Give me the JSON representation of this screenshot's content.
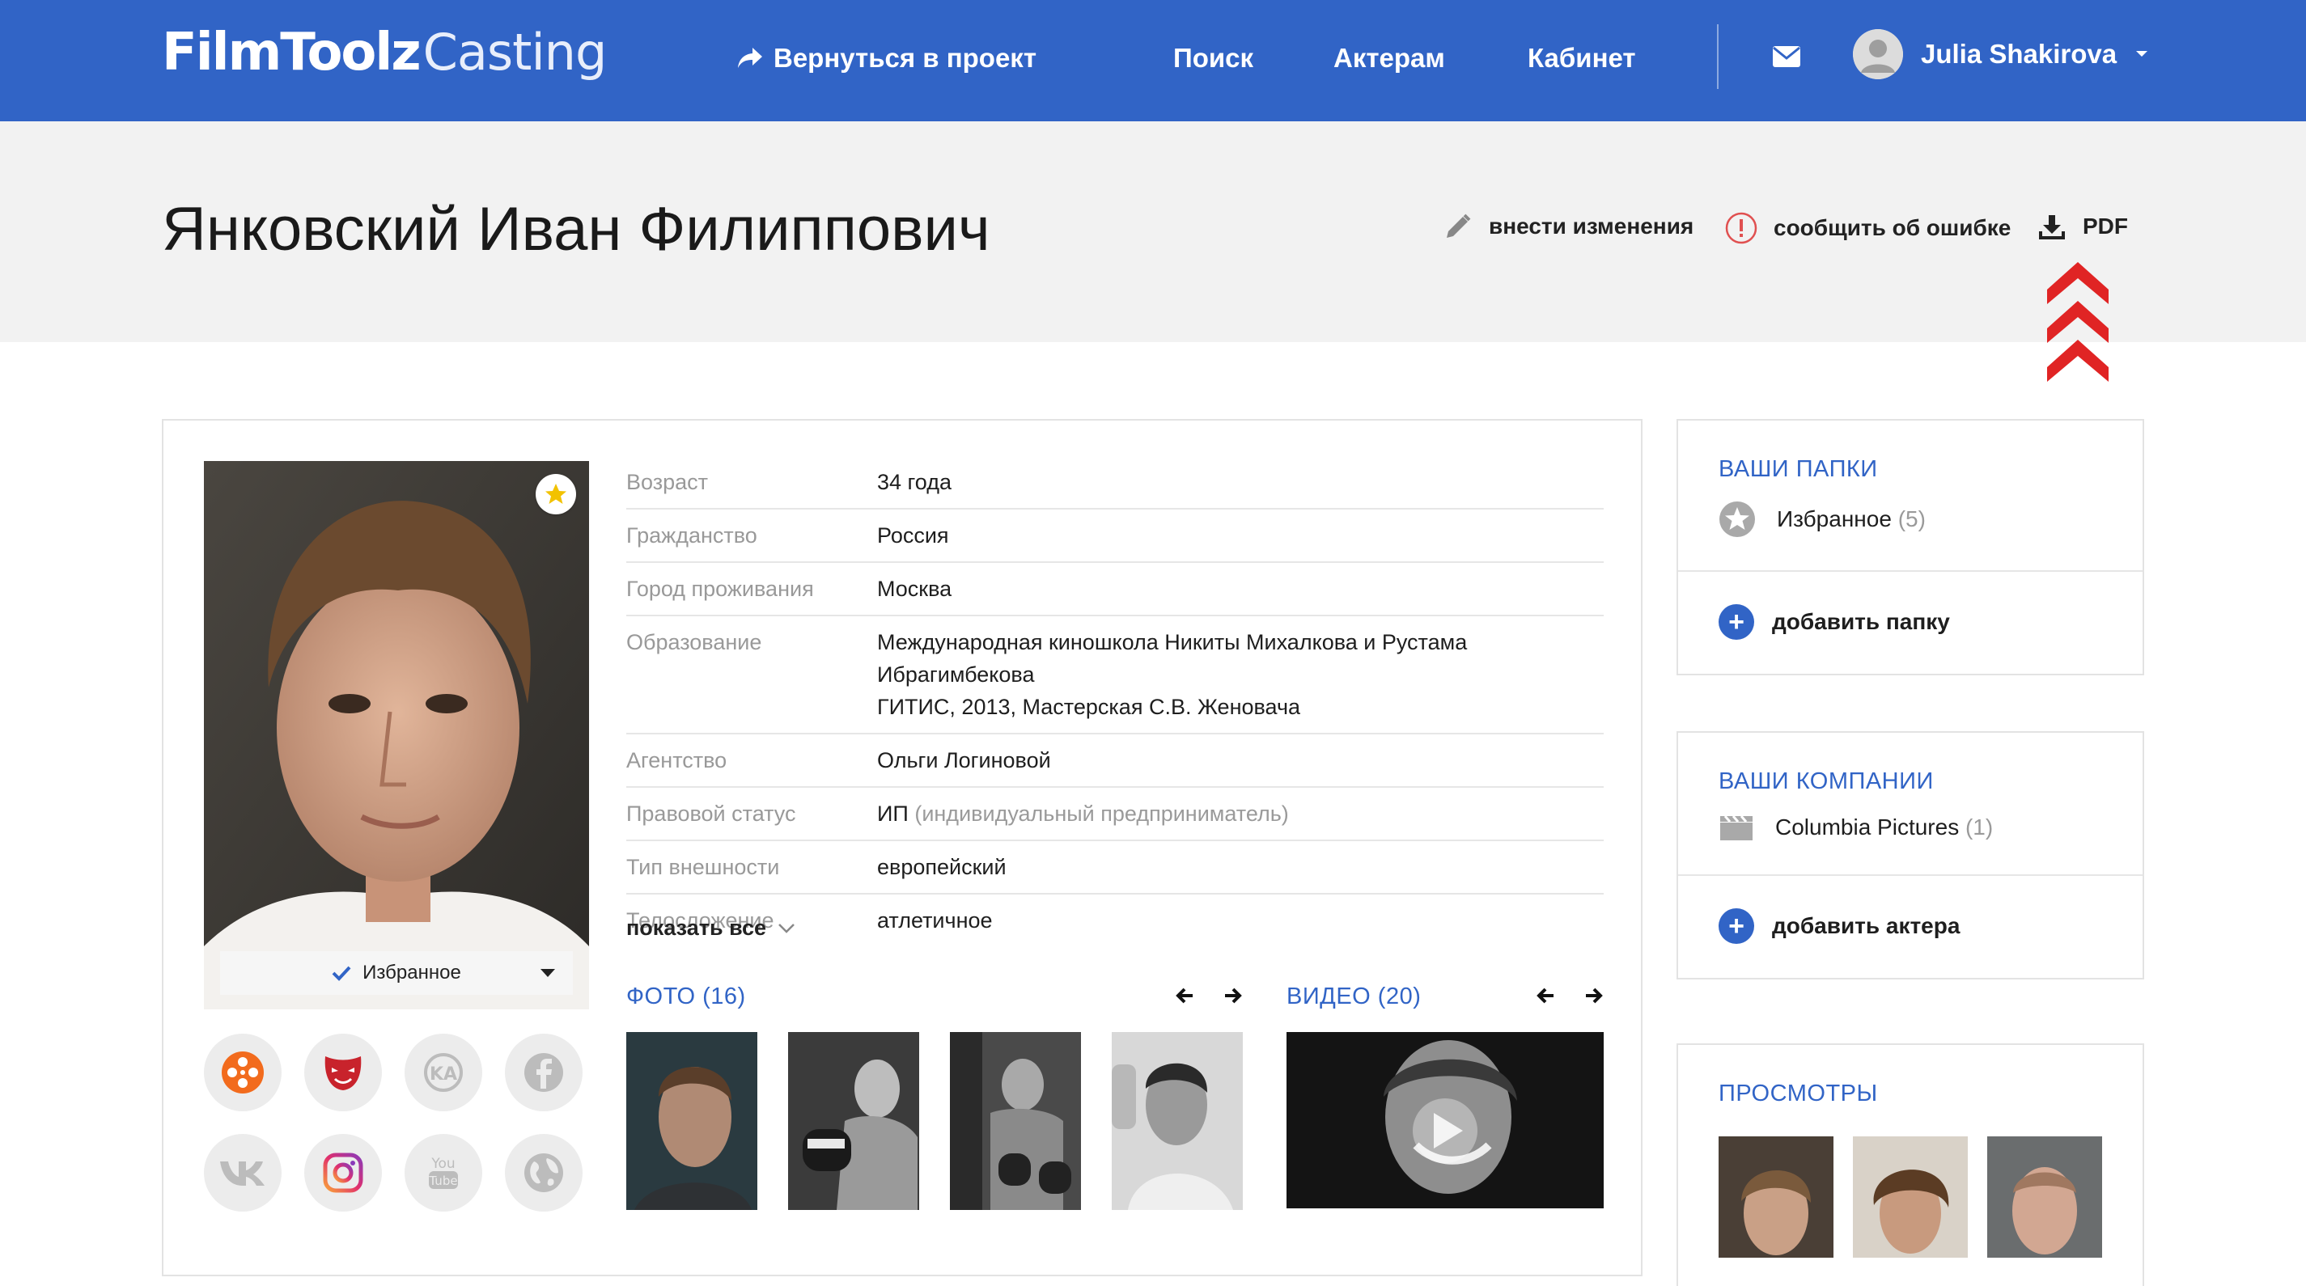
{
  "header": {
    "logo_bold": "FilmToolz",
    "logo_light": "Casting",
    "back_label": "Вернуться в проект",
    "nav": [
      "Поиск",
      "Актерам",
      "Кабинет"
    ],
    "user_name": "Julia Shakirova",
    "bg_color": "#3164c6"
  },
  "title": {
    "name": "Янковский Иван Филиппович",
    "actions": {
      "edit": "внести изменения",
      "report": "сообщить об ошибке",
      "pdf": "PDF"
    }
  },
  "profile": {
    "favorite_label": "Избранное",
    "rows": [
      {
        "label": "Возраст",
        "value": "34 года"
      },
      {
        "label": "Гражданство",
        "value": "Россия"
      },
      {
        "label": "Город проживания",
        "value": "Москва"
      },
      {
        "label": "Образование",
        "value_lines": [
          "Международная киношкола Никиты Михалкова и Рустама",
          "Ибрагимбекова",
          "ГИТИС, 2013, Мастерская С.В. Женовача"
        ]
      },
      {
        "label": "Агентство",
        "value": "Ольги Логиновой"
      },
      {
        "label": "Правовой статус",
        "value": "ИП",
        "value_muted": "(индивидуальный предприниматель)"
      },
      {
        "label": "Тип внешности",
        "value": "европейский"
      },
      {
        "label": "Телосложение",
        "value": "атлетичное"
      }
    ],
    "show_all": "показать все",
    "photos_label": "ФОТО",
    "photos_count": "(16)",
    "videos_label": "ВИДЕО",
    "videos_count": "(20)",
    "socials": [
      "kinopoisk-icon",
      "theatre-mask-icon",
      "kinoafisha-icon",
      "facebook-icon",
      "vk-icon",
      "instagram-icon",
      "youtube-icon",
      "globe-icon"
    ]
  },
  "sidebar": {
    "folders": {
      "title": "ВАШИ ПАПКИ",
      "item_label": "Избранное",
      "item_count": "(5)",
      "add_label": "добавить папку"
    },
    "companies": {
      "title": "ВАШИ КОМПАНИИ",
      "item_label": "Columbia Pictures",
      "item_count": "(1)",
      "add_label": "добавить актера"
    },
    "views": {
      "title": "ПРОСМОТРЫ"
    }
  }
}
